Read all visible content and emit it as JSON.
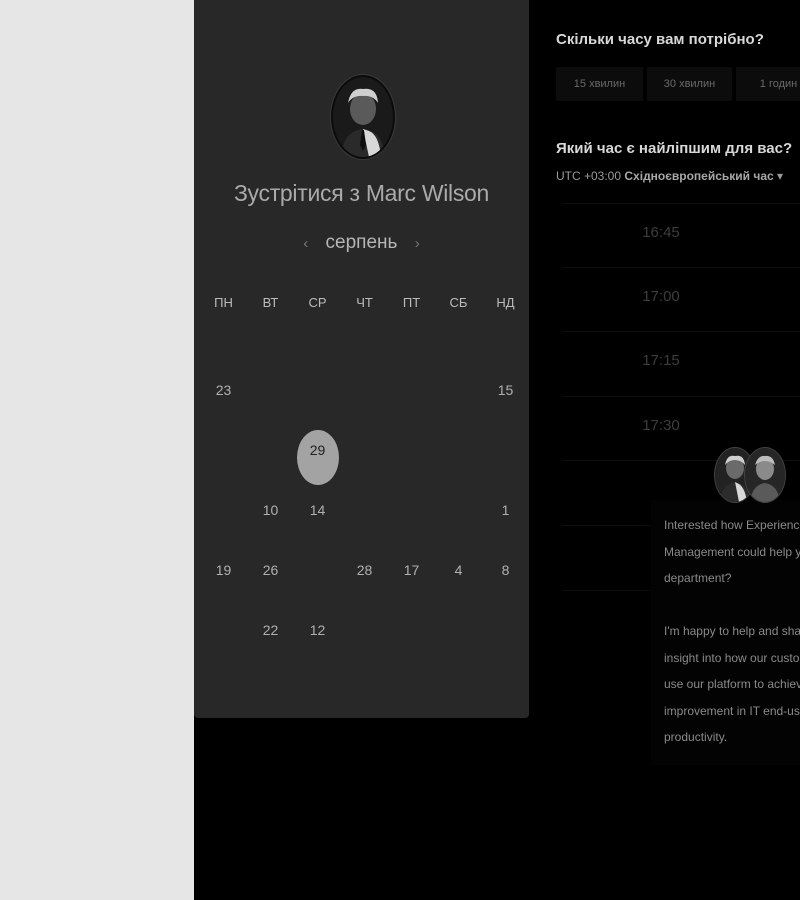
{
  "calendar": {
    "title_prefix": "Зустрітися з",
    "host_name": "Marc Wilson",
    "month": "серпень",
    "prev_arrow": "‹",
    "next_arrow": "›",
    "weekdays": [
      "ПН",
      "ВТ",
      "СР",
      "ЧТ",
      "ПТ",
      "СБ",
      "НД"
    ],
    "rows": [
      [
        {
          "d": "",
          "s": "dim"
        },
        {
          "d": "",
          "s": "dim"
        },
        {
          "d": "",
          "s": "dim"
        },
        {
          "d": "",
          "s": "dim"
        },
        {
          "d": "",
          "s": "dim"
        },
        {
          "d": "",
          "s": "dim"
        },
        {
          "d": "",
          "s": "dim"
        }
      ],
      [
        {
          "d": "23",
          "s": "active"
        },
        {
          "d": "",
          "s": "dim"
        },
        {
          "d": "",
          "s": "dim"
        },
        {
          "d": "",
          "s": "dim"
        },
        {
          "d": "",
          "s": "dim"
        },
        {
          "d": "",
          "s": "dim"
        },
        {
          "d": "15",
          "s": "active"
        }
      ],
      [
        {
          "d": "",
          "s": "dim"
        },
        {
          "d": "",
          "s": "dim"
        },
        {
          "d": "29",
          "s": "selected"
        },
        {
          "d": "",
          "s": "dim"
        },
        {
          "d": "",
          "s": "dim"
        },
        {
          "d": "",
          "s": "dim"
        },
        {
          "d": "",
          "s": "dim"
        }
      ],
      [
        {
          "d": "",
          "s": "dim"
        },
        {
          "d": "10",
          "s": "active"
        },
        {
          "d": "14",
          "s": "active"
        },
        {
          "d": "",
          "s": "dim"
        },
        {
          "d": "",
          "s": "dim"
        },
        {
          "d": "",
          "s": "dim"
        },
        {
          "d": "1",
          "s": "active"
        }
      ],
      [
        {
          "d": "19",
          "s": "active"
        },
        {
          "d": "26",
          "s": "active"
        },
        {
          "d": "",
          "s": "dim"
        },
        {
          "d": "28",
          "s": "active"
        },
        {
          "d": "17",
          "s": "active"
        },
        {
          "d": "4",
          "s": "active"
        },
        {
          "d": "8",
          "s": "active"
        }
      ],
      [
        {
          "d": "",
          "s": "dim"
        },
        {
          "d": "22",
          "s": "active"
        },
        {
          "d": "12",
          "s": "active"
        },
        {
          "d": "",
          "s": "dim"
        },
        {
          "d": "",
          "s": "dim"
        },
        {
          "d": "",
          "s": "dim"
        },
        {
          "d": "",
          "s": "dim"
        }
      ]
    ]
  },
  "booking": {
    "duration_question": "Скільки часу вам потрібно?",
    "durations": [
      "15 хвилин",
      "30 хвилин",
      "1 годин"
    ],
    "time_question": "Який час є найліпшим для вас?",
    "timezone_offset": "UTC +03:00",
    "timezone_name": "Східноєвропейський час",
    "timezone_caret": "▾",
    "slots": [
      "16:45",
      "17:00",
      "17:15",
      "17:30"
    ]
  },
  "chat": {
    "message": "Interested how Experience\nManagement could help y\ndepartment?\n\nI'm happy to help and shar\ninsight into how our custor\nuse our platform to achiev\nimprovement in IT end-use\nproductivity."
  }
}
